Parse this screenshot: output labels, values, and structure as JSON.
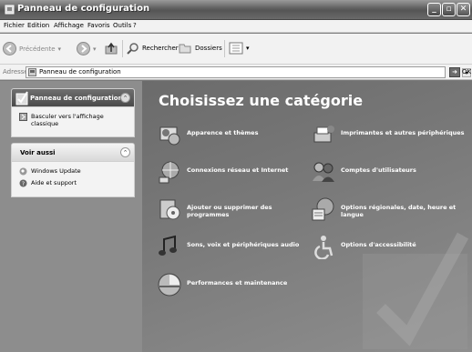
{
  "window": {
    "title": "Panneau de configuration"
  },
  "menu": [
    "Fichier",
    "Edition",
    "Affichage",
    "Favoris",
    "Outils",
    "?"
  ],
  "toolbar": {
    "back": "Précédente",
    "search": "Rechercher",
    "folders": "Dossiers"
  },
  "address": {
    "label": "Adresse",
    "value": "Panneau de configuration",
    "go": "OK"
  },
  "sidebar": {
    "panel1": {
      "title": "Panneau de configuration",
      "links": [
        "Basculer vers l'affichage classique"
      ]
    },
    "panel2": {
      "title": "Voir aussi",
      "links": [
        "Windows Update",
        "Aide et support"
      ]
    }
  },
  "main": {
    "heading": "Choisissez une catégorie",
    "categories": [
      "Apparence et thèmes",
      "Imprimantes et autres périphériques",
      "Connexions réseau et Internet",
      "Comptes d'utilisateurs",
      "Ajouter ou supprimer des programmes",
      "Options régionales, date, heure et langue",
      "Sons, voix et périphériques audio",
      "Options d'accessibilité",
      "Performances et maintenance"
    ]
  }
}
